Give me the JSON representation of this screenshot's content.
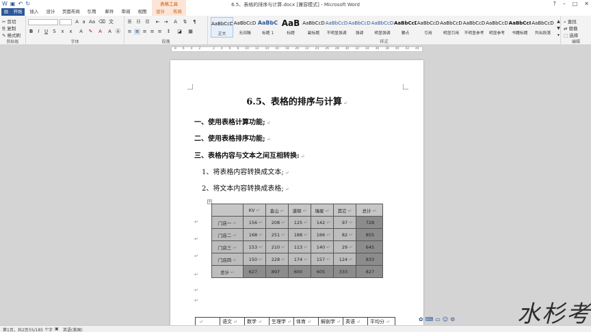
{
  "window": {
    "title": "6.5、表格的排序与计算.docx [兼容模式] - Microsoft Word",
    "context_tab_header": "表格工具"
  },
  "tabs": [
    "开始",
    "插入",
    "设计",
    "页面布局",
    "引用",
    "邮件",
    "审阅",
    "视图",
    "设计",
    "布局"
  ],
  "ribbon": {
    "clipboard": {
      "cut": "剪切",
      "copy": "复制",
      "format_painter": "格式刷",
      "label": "剪贴板"
    },
    "font": {
      "label": "字体",
      "bold": "B",
      "italic": "I",
      "underline": "U"
    },
    "paragraph": {
      "label": "段落"
    },
    "styles": {
      "label": "样式",
      "items": [
        {
          "sample": "AaBbCcD",
          "name": "正文"
        },
        {
          "sample": "AaBbCcD",
          "name": "无间隔"
        },
        {
          "sample": "AaBbC",
          "name": "标题 1"
        },
        {
          "sample": "AaB",
          "name": "标题"
        },
        {
          "sample": "AaBbCcD",
          "name": "副标题"
        },
        {
          "sample": "AaBbCcD",
          "name": "不明显强调"
        },
        {
          "sample": "AaBbCcD",
          "name": "强调"
        },
        {
          "sample": "AaBbCcD",
          "name": "明显强调"
        },
        {
          "sample": "AaBbCcD",
          "name": "要点"
        },
        {
          "sample": "AaBbCcD",
          "name": "引用"
        },
        {
          "sample": "AaBbCcD",
          "name": "明显引用"
        },
        {
          "sample": "AaBbCcD",
          "name": "不明显参考"
        },
        {
          "sample": "AaBbCcD",
          "name": "明显参考"
        },
        {
          "sample": "AaBbCcI",
          "name": "书籍标题"
        },
        {
          "sample": "AaBbCcD",
          "name": "列出段落"
        }
      ]
    },
    "editing": {
      "find": "查找",
      "replace": "替换",
      "select": "选择",
      "label": "编辑"
    }
  },
  "ruler": {
    "marks": [
      "8",
      "6",
      "4",
      "2",
      "",
      "2",
      "4",
      "6",
      "8",
      "10",
      "12",
      "14",
      "16",
      "18",
      "20",
      "22",
      "24",
      "26",
      "28",
      "30",
      "32",
      "34",
      "36",
      "38",
      "40",
      "42",
      "44"
    ]
  },
  "document": {
    "title": "6.5、表格的排序与计算",
    "headings": [
      "一、使用表格计算功能;",
      "二、使用表格排序功能;",
      "三、表格内容与文本之间互相转换:"
    ],
    "subitems": [
      "1、将表格内容转换成文本;",
      "2、将文本内容转换成表格;"
    ],
    "para_mark": "↵",
    "table": {
      "header": [
        "",
        "KV",
        "金山",
        "道顿",
        "瑞星",
        "其它",
        "总计"
      ],
      "rows": [
        [
          "门店一",
          "156",
          "208",
          "125",
          "142",
          "97",
          "728"
        ],
        [
          "门店二",
          "168",
          "251",
          "188",
          "166",
          "82",
          "855"
        ],
        [
          "门店三",
          "153",
          "210",
          "113",
          "140",
          "29",
          "645"
        ],
        [
          "门店四",
          "150",
          "228",
          "174",
          "157",
          "124",
          "833"
        ],
        [
          "总计",
          "627",
          "897",
          "600",
          "605",
          "333",
          "827"
        ]
      ]
    },
    "table2_header": [
      "",
      "语文",
      "数学",
      "生理学",
      "体育",
      "解剖学",
      "英语",
      "平均分"
    ]
  },
  "status": {
    "page": "第1页，共2页",
    "words": "55/185 个字",
    "language": "英语(美国)"
  },
  "watermark": "水杉考试"
}
